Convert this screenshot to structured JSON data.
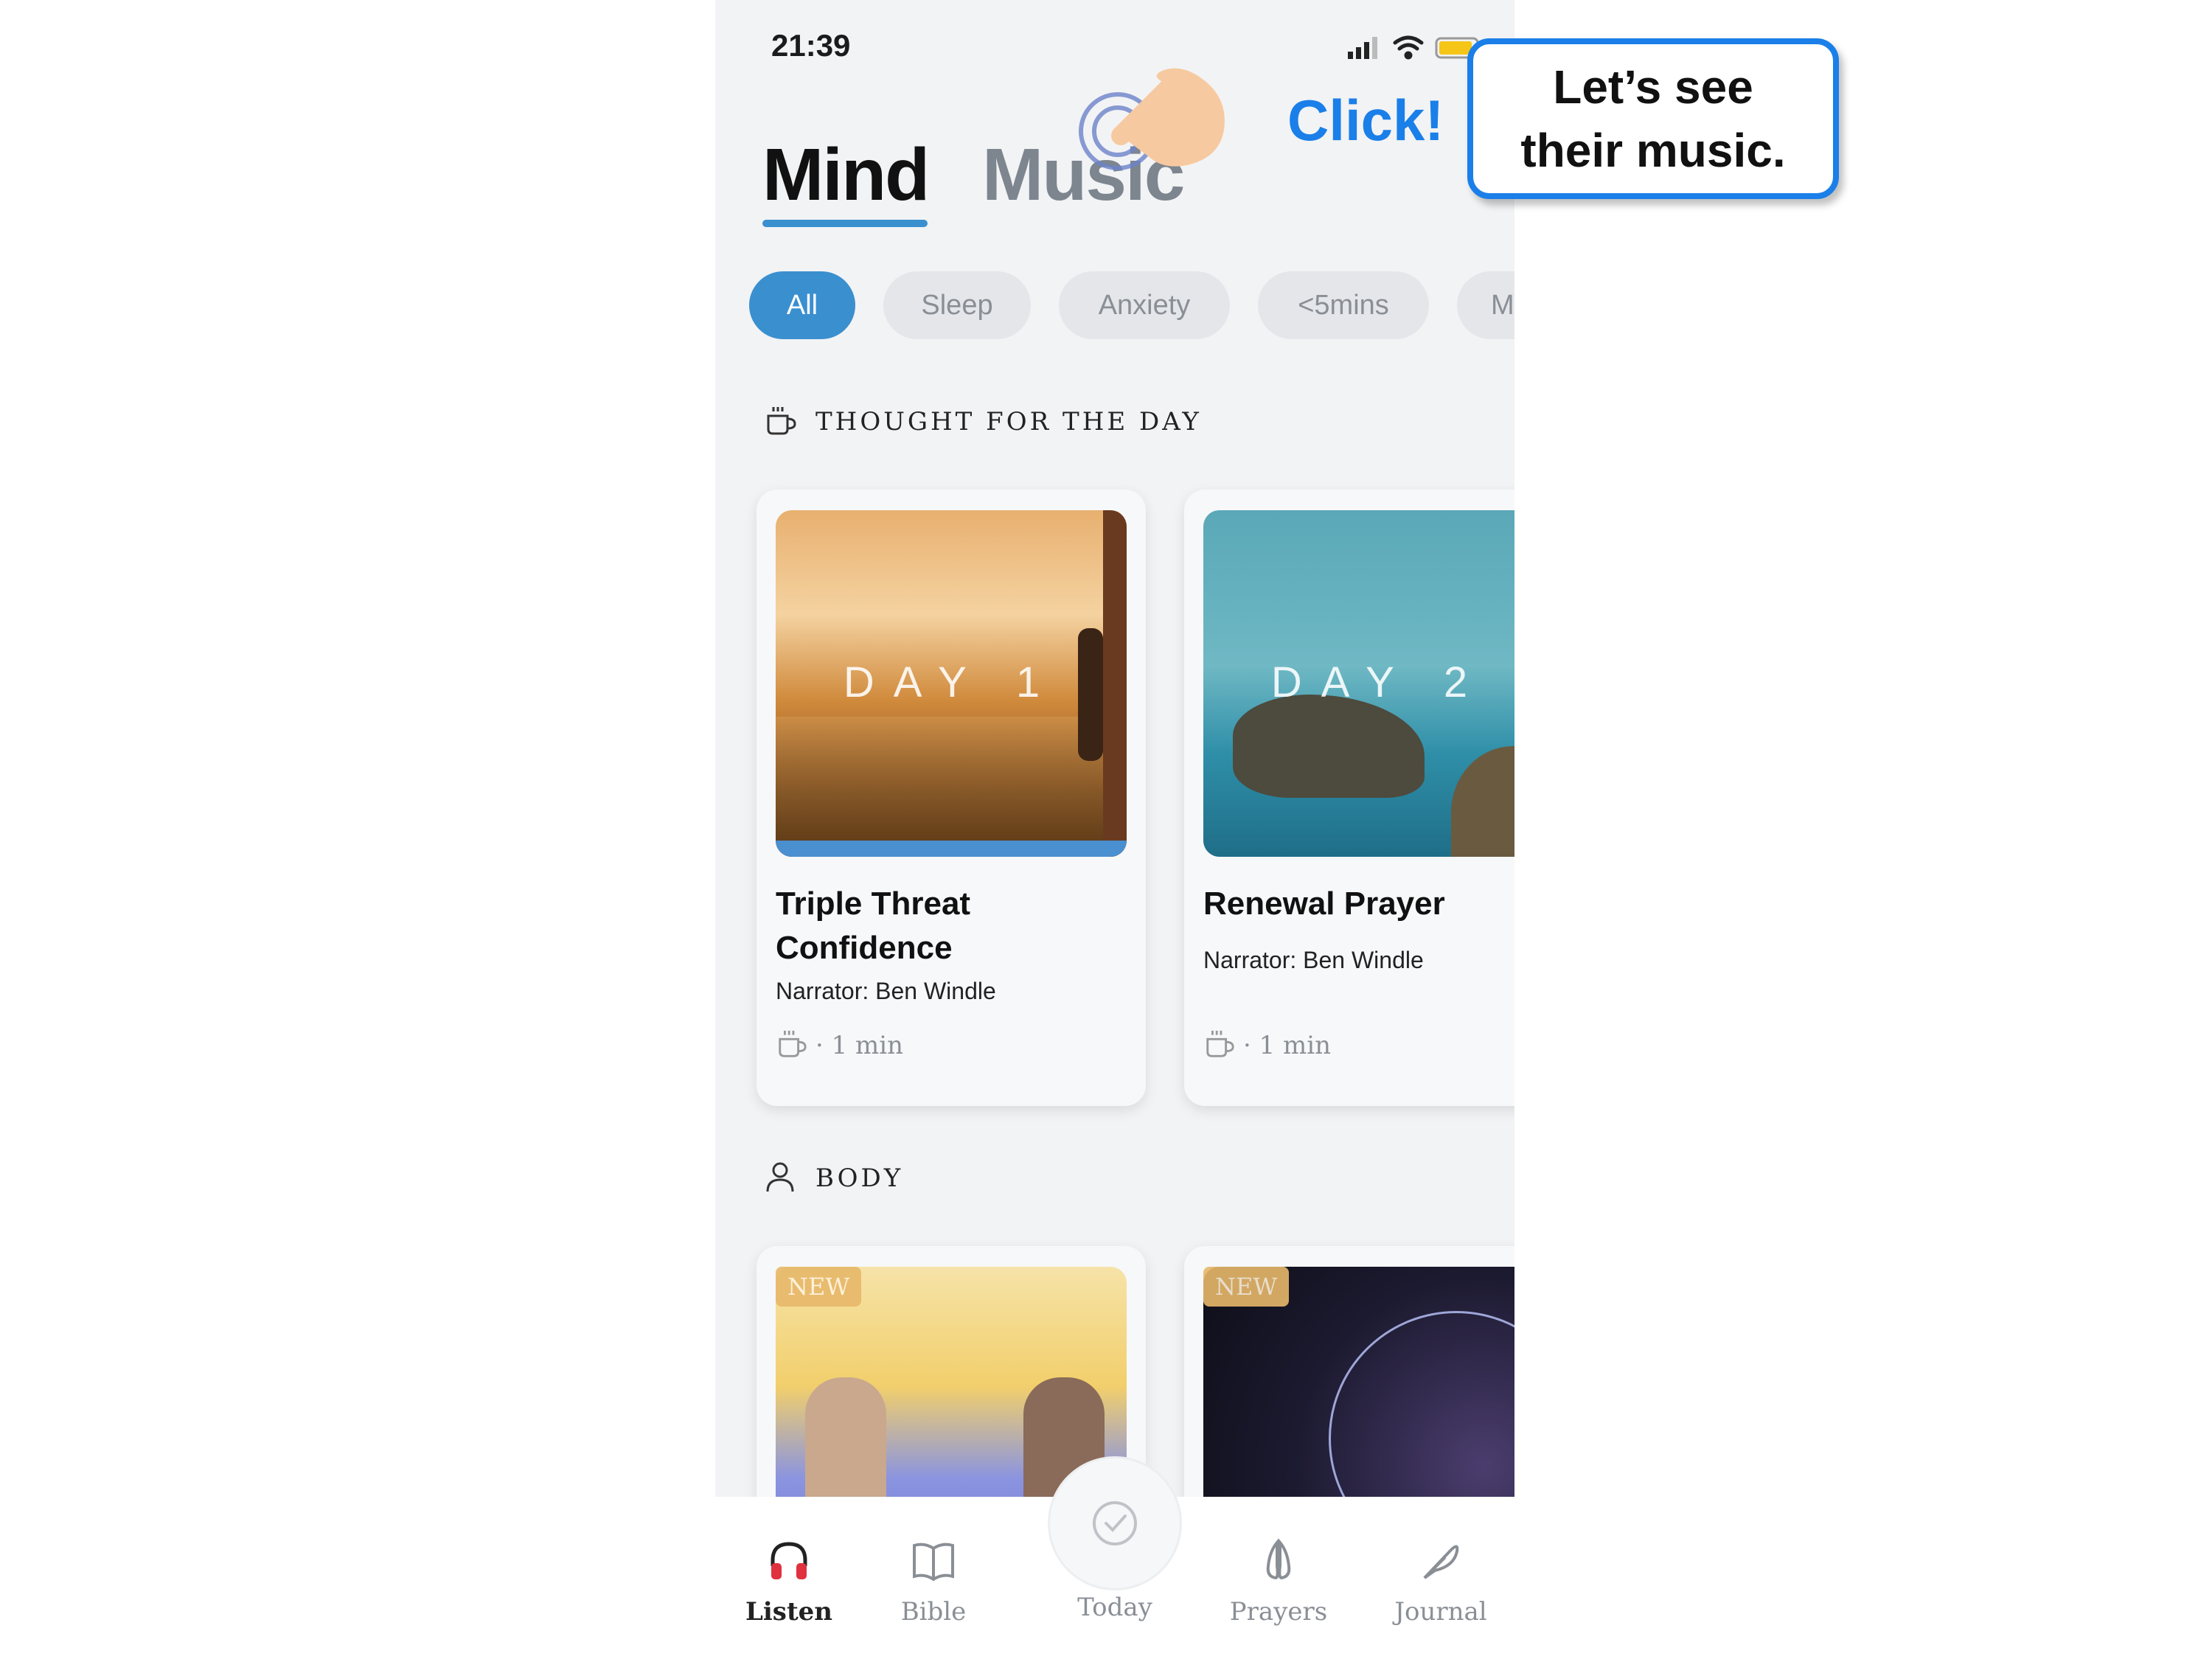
{
  "status_bar": {
    "time": "21:39"
  },
  "tabs": {
    "mind": "Mind",
    "music": "Music"
  },
  "filters": [
    "All",
    "Sleep",
    "Anxiety",
    "<5mins",
    "Mo"
  ],
  "thought_section": {
    "heading": "THOUGHT FOR THE DAY",
    "cards": [
      {
        "image_text": "DAY 1",
        "title_line1": "Triple Threat",
        "title_line2": "Confidence",
        "narrator": "Narrator: Ben Windle",
        "duration": "· 1 min"
      },
      {
        "image_text": "DAY 2",
        "title": "Renewal Prayer",
        "narrator": "Narrator: Ben Windle",
        "duration": "· 1 min"
      }
    ]
  },
  "body_section": {
    "heading": "BODY",
    "badges": [
      "NEW",
      "NEW"
    ]
  },
  "bottom_nav": [
    "Listen",
    "Bible",
    "Today",
    "Prayers",
    "Journal"
  ],
  "annotation": {
    "click_label": "Click!",
    "callout_line1": "Let’s see",
    "callout_line2": "their music."
  },
  "colors": {
    "accent": "#3a8fcf",
    "annotation_blue": "#1a7fe8",
    "listen_icon": "#e0313f"
  }
}
